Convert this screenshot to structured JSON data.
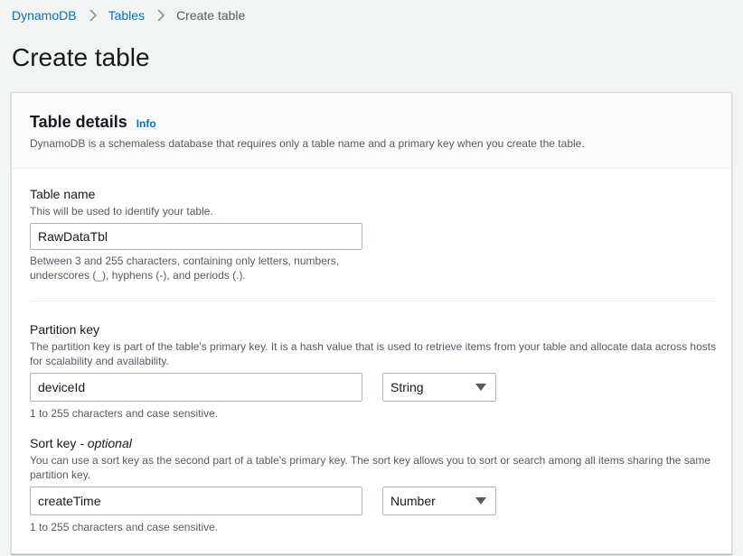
{
  "breadcrumb": {
    "items": [
      "DynamoDB",
      "Tables",
      "Create table"
    ]
  },
  "page": {
    "title": "Create table"
  },
  "panel": {
    "title": "Table details",
    "info_label": "Info",
    "description": "DynamoDB is a schemaless database that requires only a table name and a primary key when you create the table."
  },
  "table_name": {
    "label": "Table name",
    "description": "This will be used to identify your table.",
    "value": "RawDataTbl",
    "constraint_line1": "Between 3 and 255 characters, containing only letters, numbers,",
    "constraint_line2": "underscores (_), hyphens (-), and periods (.)."
  },
  "partition_key": {
    "label": "Partition key",
    "description": "The partition key is part of the table's primary key. It is a hash value that is used to retrieve items from your table and allocate data across hosts for scalability and availability.",
    "value": "deviceId",
    "type_selected": "String",
    "constraint": "1 to 255 characters and case sensitive."
  },
  "sort_key": {
    "label": "Sort key",
    "label_suffix": " - optional",
    "description": "You can use a sort key as the second part of a table's primary key. The sort key allows you to sort or search among all items sharing the same partition key.",
    "value": "createTime",
    "type_selected": "Number",
    "constraint": "1 to 255 characters and case sensitive."
  },
  "colors": {
    "link": "#0073bb",
    "text": "#16191f",
    "muted": "#545b64",
    "background": "#f2f3f3"
  }
}
